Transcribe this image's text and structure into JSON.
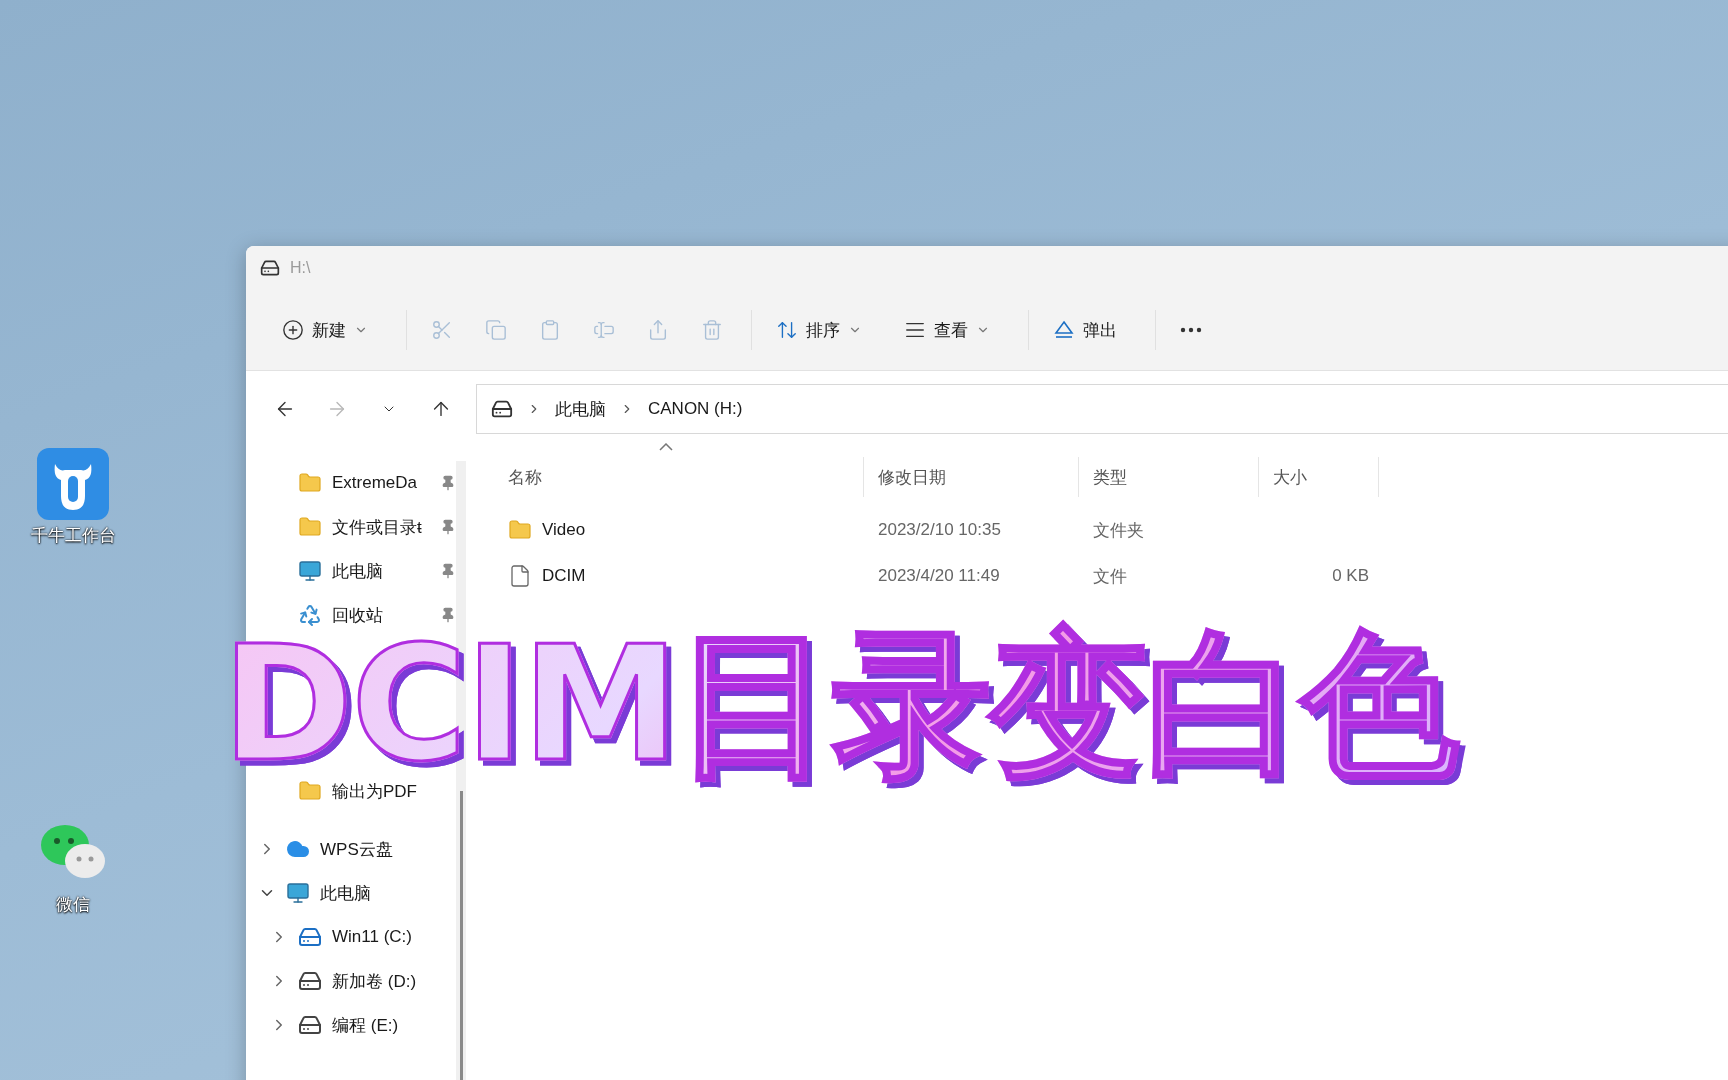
{
  "desktop_icons": [
    {
      "kind": "qianniu",
      "label": "千牛工作台"
    },
    {
      "kind": "chat",
      "label": "微信"
    }
  ],
  "window": {
    "title": "H:\\"
  },
  "toolbar": [
    {
      "kind": "new",
      "label": "新建",
      "disabled": false,
      "dropdown": true
    },
    {
      "kind": "cut",
      "disabled": true
    },
    {
      "kind": "copy",
      "disabled": true
    },
    {
      "kind": "paste",
      "disabled": true
    },
    {
      "kind": "rename",
      "disabled": true
    },
    {
      "kind": "share",
      "disabled": true
    },
    {
      "kind": "delete",
      "disabled": true
    },
    {
      "kind": "sort",
      "label": "排序",
      "disabled": false,
      "dropdown": true
    },
    {
      "kind": "view",
      "label": "查看",
      "disabled": false,
      "dropdown": true
    },
    {
      "kind": "eject",
      "label": "弹出",
      "disabled": false,
      "dropdown": false
    },
    {
      "kind": "more",
      "disabled": false
    }
  ],
  "nav": [
    {
      "kind": "back",
      "disabled": false
    },
    {
      "kind": "forward",
      "disabled": true
    },
    {
      "kind": "recent",
      "disabled": false
    },
    {
      "kind": "up",
      "disabled": false
    }
  ],
  "address": {
    "crumbs": [
      "此电脑",
      "CANON (H:)"
    ]
  },
  "sidebar": {
    "pinned": [
      {
        "kind": "folder",
        "label": "ExtremeDa",
        "pinned": true
      },
      {
        "kind": "folder",
        "label": "文件或目录ŧ",
        "pinned": true
      },
      {
        "kind": "monitor",
        "label": "此电脑",
        "pinned": true
      },
      {
        "kind": "recycle",
        "label": "回收站",
        "pinned": true
      },
      {
        "kind": "folder",
        "label": "输出为PDF",
        "pinned": false
      }
    ],
    "tree": [
      {
        "kind": "cloud",
        "label": "WPS云盘",
        "expanded": false
      },
      {
        "kind": "monitor",
        "label": "此电脑",
        "expanded": true,
        "children": [
          {
            "kind": "windrive",
            "label": "Win11 (C:)",
            "expanded": false
          },
          {
            "kind": "drive",
            "label": "新加卷 (D:)",
            "expanded": false
          },
          {
            "kind": "drive",
            "label": "编程 (E:)",
            "expanded": false
          }
        ]
      }
    ]
  },
  "columns": [
    {
      "label": "名称",
      "sorted": true
    },
    {
      "label": "修改日期",
      "sorted": false
    },
    {
      "label": "类型",
      "sorted": false
    },
    {
      "label": "大小",
      "sorted": false
    }
  ],
  "rows": [
    {
      "kind": "folder",
      "name": "Video",
      "modified": "2023/2/10 10:35",
      "type": "文件夹"
    },
    {
      "kind": "file",
      "name": "DCIM",
      "modified": "2023/4/20 11:49",
      "type": "文件",
      "size": "0 KB"
    }
  ],
  "overlay_title": "DCIM目录变白色"
}
